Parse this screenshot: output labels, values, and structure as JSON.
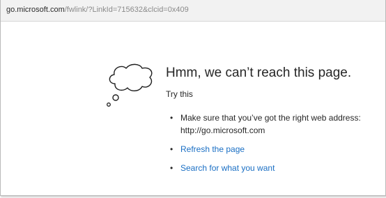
{
  "address_bar": {
    "host": "go.microsoft.com",
    "path": "/fwlink/?LinkId=715632&clcid=0x409"
  },
  "error_page": {
    "icon": "thought-cloud-icon",
    "headline": "Hmm, we can’t reach this page.",
    "try_this": "Try this",
    "bullet": "•",
    "suggestion_1_line_1": "Make sure that you’ve got the right web address:",
    "suggestion_1_line_2": "http://go.microsoft.com",
    "refresh_link": "Refresh the page",
    "search_link": "Search for what you want"
  },
  "colors": {
    "link": "#1a6fc4",
    "text": "#262626",
    "address_bar_bg": "#f2f2f2"
  }
}
